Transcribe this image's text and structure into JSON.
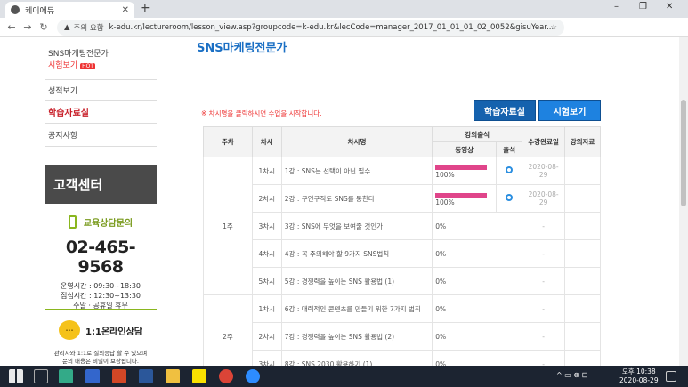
{
  "browser": {
    "tab_title": "케이에듀",
    "tab_close": "✕",
    "new_tab": "+",
    "win_minimize": "–",
    "win_restore": "❐",
    "win_close": "✕",
    "security_label": "주의 요함",
    "url": "k-edu.kr/lectureroom/lesson_view.asp?groupcode=k-edu.kr&lecCode=manager_2017_01_01_01_02_0052&gisuYear...",
    "avatar_letter": "K"
  },
  "sidebar": {
    "course_item_line1": "SNS마케팅전문가",
    "course_item_line2": "시험보기",
    "hot_badge": "HOT",
    "items": [
      {
        "label": "성적보기"
      },
      {
        "label": "학습자료실"
      },
      {
        "label": "공지사항"
      }
    ]
  },
  "customer_center": {
    "title": "고객센터",
    "consult_label": "교육상담문의",
    "phone": "02-465-9568",
    "hours_line1": "운영시간 : 09:30~18:30",
    "hours_line2": "점심시간 : 12:30~13:30",
    "hours_line3": "주말 · 공휴일 휴무",
    "online_label": "1:1온라인상담",
    "online_icon": "···",
    "online_desc_line1": "관리자와 1:1로 질의응답 할 수 있으며",
    "online_desc_line2": "문의 내용은 비밀이 보장됩니다."
  },
  "main": {
    "course_title": "SNS마케팅전문가",
    "notice": "※ 차시명을 클릭하시면 수업을 시작합니다.",
    "btn_materials": "학습자료실",
    "btn_exam": "시험보기",
    "headers": {
      "week": "주차",
      "session": "차시",
      "session_name": "차시명",
      "attendance": "강의출석",
      "video": "동영상",
      "check": "출석",
      "period": "수강완료일",
      "materials": "강의자료"
    },
    "week1_label": "1주",
    "rows": [
      {
        "session": "1차시",
        "name": "1강 : SNS는 선택이 아닌 필수",
        "progress": "100%",
        "pct": 100,
        "date": "2020-08-29"
      },
      {
        "session": "2차시",
        "name": "2강 : 구인구직도 SNS를 통한다",
        "progress": "100%",
        "pct": 100,
        "date": "2020-08-29"
      },
      {
        "session": "3차시",
        "name": "3강 : SNS에 무엇을 보여줄 것인가",
        "progress": "0%",
        "pct": 0,
        "date": "-"
      },
      {
        "session": "4차시",
        "name": "4강 : 꼭 주의해야 할 9가지 SNS법칙",
        "progress": "0%",
        "pct": 0,
        "date": "-"
      },
      {
        "session": "5차시",
        "name": "5강 : 경쟁력을 높이는 SNS 활용법 (1)",
        "progress": "0%",
        "pct": 0,
        "date": "-"
      },
      {
        "session": "1차시",
        "name": "6강 : 매력적인 콘텐츠를 만들기 위한 7가지 법칙",
        "progress": "0%",
        "pct": 0,
        "date": "-"
      },
      {
        "session": "2차시",
        "name": "7강 : 경쟁력을 높이는 SNS 활용법 (2)",
        "progress": "0%",
        "pct": 0,
        "date": "-"
      },
      {
        "session": "3차시",
        "name": "8강 : SNS 2030 활용하기 (1)",
        "progress": "0%",
        "pct": 0,
        "date": "-"
      }
    ],
    "week2_label": "2주"
  },
  "taskbar": {
    "time": "오후 10:38",
    "date": "2020-08-29"
  },
  "colors": {
    "accent_blue": "#1a73c8",
    "active_red": "#c8202a",
    "progress_pink": "#e0458a",
    "green": "#8ab61f"
  }
}
